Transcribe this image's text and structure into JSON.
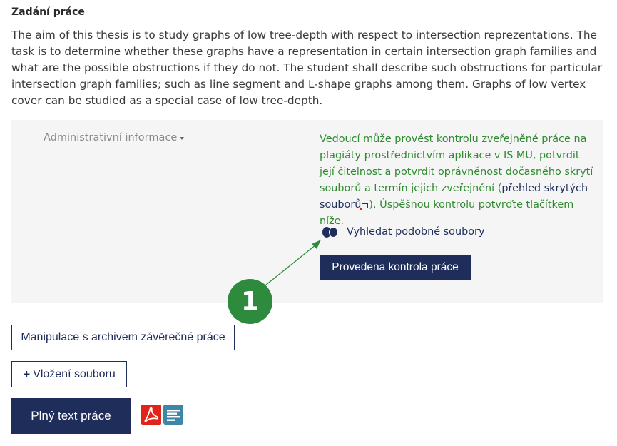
{
  "assignment": {
    "heading": "Zadání práce",
    "text": "The aim of this thesis is to study graphs of low tree-depth with respect to intersection reprezentations. The task is to determine whether these graphs have a representation in certain intersection graph families and what are the possible obstructions if they do not. The student shall describe such obstructions for particular intersection graph families; such as line segment and L-shape graphs among them. Graphs of low vertex cover can be studied as a special case of low tree-depth."
  },
  "admin": {
    "toggle_label": "Administrativní informace",
    "note_part1": "Vedoucí může provést kontrolu zveřejněné práce na plagiáty prostřednictvím aplikace v IS MU, potvrdit její čitelnost a potvrdit oprávněnost dočasného skrytí souborů a termín jejich zveřejnění (",
    "note_link": "přehled skrytých souborů",
    "note_part2": "). Úspěšnou kontrolu potvrďte tlačítkem níže.",
    "similar_files_label": "Vyhledat podobné soubory",
    "check_button_label": "Provedena kontrola práce"
  },
  "actions": {
    "archive_button_label": "Manipulace s archivem závěrečné práce",
    "upload_button_label": "Vložení souboru",
    "fulltext_button_label": "Plný text práce"
  },
  "annotation": {
    "callout_number": "1",
    "color": "#2e8b3e"
  },
  "colors": {
    "brand_navy": "#1f2d5a",
    "note_green": "#2e8b2e",
    "pdf_red": "#e2231a",
    "text_icon_blue": "#3d86a6"
  }
}
